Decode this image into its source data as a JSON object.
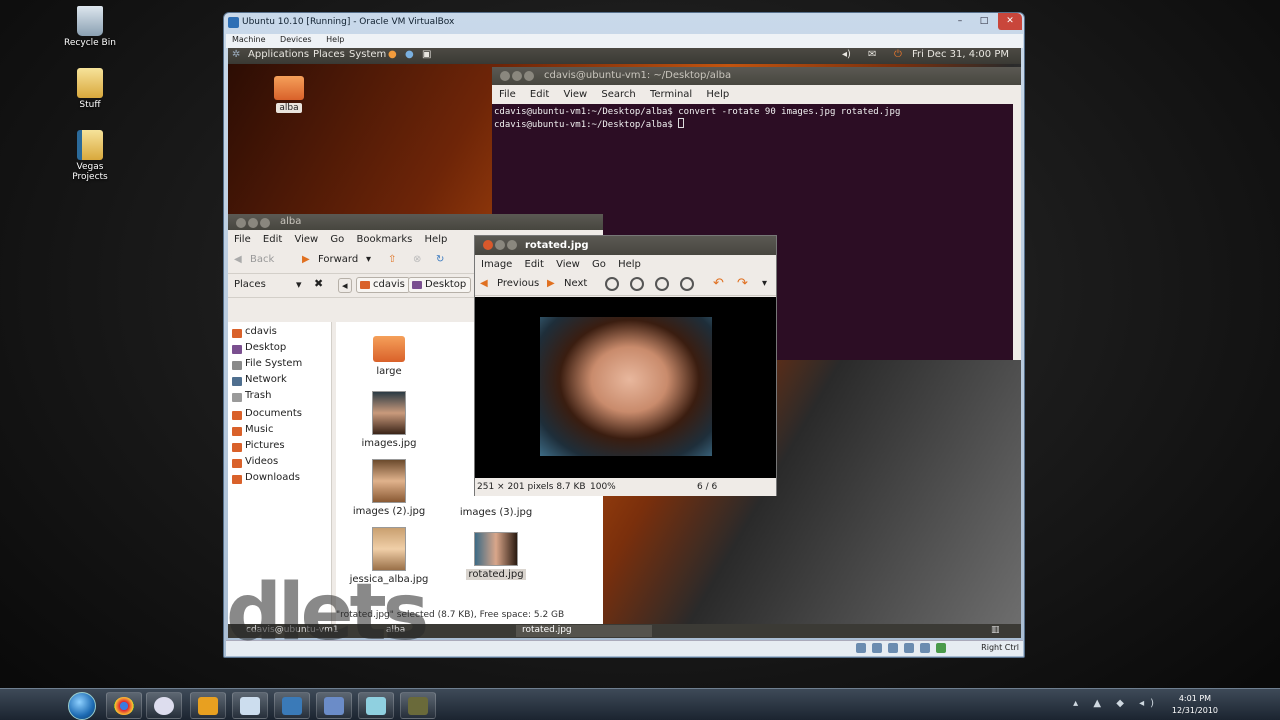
{
  "desktop_icons": [
    {
      "label": "Recycle Bin"
    },
    {
      "label": "Stuff"
    },
    {
      "label": "Vegas Projects"
    }
  ],
  "vbox": {
    "title": "Ubuntu 10.10 [Running] - Oracle VM VirtualBox",
    "menu": [
      "Machine",
      "Devices",
      "Help"
    ],
    "host_key": "Right Ctrl"
  },
  "ubuntu_panel": {
    "applications": "Applications",
    "places": "Places",
    "system": "System",
    "datetime": "Fri Dec 31,  4:00 PM"
  },
  "desktop_folder": {
    "label": "alba"
  },
  "terminal": {
    "title": "cdavis@ubuntu-vm1: ~/Desktop/alba",
    "menu": [
      "File",
      "Edit",
      "View",
      "Search",
      "Terminal",
      "Help"
    ],
    "line1": "cdavis@ubuntu-vm1:~/Desktop/alba$ convert -rotate 90 images.jpg rotated.jpg",
    "line2": "cdavis@ubuntu-vm1:~/Desktop/alba$ "
  },
  "nautilus": {
    "title": "alba",
    "menu": [
      "File",
      "Edit",
      "View",
      "Go",
      "Bookmarks",
      "Help"
    ],
    "back": "Back",
    "forward": "Forward",
    "places_label": "Places",
    "breadcrumbs": [
      "cdavis",
      "Desktop"
    ],
    "sidebar": [
      {
        "label": "cdavis",
        "color": "#d9612a"
      },
      {
        "label": "Desktop",
        "color": "#7a4f8f"
      },
      {
        "label": "File System",
        "color": "#8a8a8a"
      },
      {
        "label": "Network",
        "color": "#4f6f8f"
      },
      {
        "label": "Trash",
        "color": "#9a9a9a"
      },
      {
        "label": "Documents",
        "color": "#d9612a"
      },
      {
        "label": "Music",
        "color": "#d9612a"
      },
      {
        "label": "Pictures",
        "color": "#d9612a"
      },
      {
        "label": "Videos",
        "color": "#d9612a"
      },
      {
        "label": "Downloads",
        "color": "#d9612a"
      }
    ],
    "files": [
      {
        "label": "large"
      },
      {
        "label": "images.jpg"
      },
      {
        "label": "images (2).jpg"
      },
      {
        "label": "images (3).jpg"
      },
      {
        "label": "jessica_alba.jpg"
      },
      {
        "label": "rotated.jpg"
      }
    ],
    "status": "\"rotated.jpg\" selected (8.7 KB), Free space: 5.2 GB"
  },
  "eog": {
    "title": "rotated.jpg",
    "menu": [
      "Image",
      "Edit",
      "View",
      "Go",
      "Help"
    ],
    "previous": "Previous",
    "next": "Next",
    "dimensions": "251 × 201 pixels  8.7 KB",
    "zoom": "100%",
    "position": "6 / 6"
  },
  "ubuntu_tasks": [
    "cdavis@ubuntu-vm1",
    "alba",
    "rotated.jpg"
  ],
  "win_clock": {
    "time": "4:01 PM",
    "date": "12/31/2010"
  }
}
